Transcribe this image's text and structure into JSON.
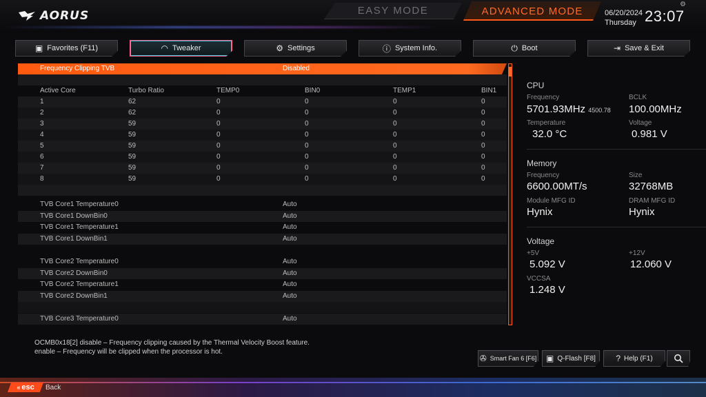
{
  "brand": {
    "logo_text": "AORUS"
  },
  "modes": {
    "easy": "EASY MODE",
    "advanced": "ADVANCED MODE"
  },
  "datetime": {
    "date": "06/20/2024",
    "day": "Thursday",
    "time": "23:07"
  },
  "tabs": [
    {
      "label": "Favorites (F11)",
      "icon": "favorites-icon"
    },
    {
      "label": "Tweaker",
      "icon": "speedometer-icon"
    },
    {
      "label": "Settings",
      "icon": "gear-icon"
    },
    {
      "label": "System Info.",
      "icon": "info-icon"
    },
    {
      "label": "Boot",
      "icon": "power-icon"
    },
    {
      "label": "Save & Exit",
      "icon": "exit-icon"
    }
  ],
  "main": {
    "highlight": {
      "label": "Frequency Clipping TVB",
      "value": "Disabled"
    },
    "table": {
      "headers": [
        "Active Core",
        "Turbo Ratio",
        "TEMP0",
        "BIN0",
        "TEMP1",
        "BIN1"
      ],
      "rows": [
        [
          "1",
          "62",
          "0",
          "0",
          "0",
          "0"
        ],
        [
          "2",
          "62",
          "0",
          "0",
          "0",
          "0"
        ],
        [
          "3",
          "59",
          "0",
          "0",
          "0",
          "0"
        ],
        [
          "4",
          "59",
          "0",
          "0",
          "0",
          "0"
        ],
        [
          "5",
          "59",
          "0",
          "0",
          "0",
          "0"
        ],
        [
          "6",
          "59",
          "0",
          "0",
          "0",
          "0"
        ],
        [
          "7",
          "59",
          "0",
          "0",
          "0",
          "0"
        ],
        [
          "8",
          "59",
          "0",
          "0",
          "0",
          "0"
        ]
      ]
    },
    "settings": [
      {
        "label": "TVB Core1 Temperature0",
        "value": "Auto"
      },
      {
        "label": "TVB Core1 DownBin0",
        "value": "Auto"
      },
      {
        "label": "TVB Core1 Temperature1",
        "value": "Auto"
      },
      {
        "label": "TVB Core1 DownBin1",
        "value": "Auto"
      },
      {
        "label": "TVB Core2 Temperature0",
        "value": "Auto"
      },
      {
        "label": "TVB Core2 DownBin0",
        "value": "Auto"
      },
      {
        "label": "TVB Core2 Temperature1",
        "value": "Auto"
      },
      {
        "label": "TVB Core2 DownBin1",
        "value": "Auto"
      },
      {
        "label": "TVB Core3 Temperature0",
        "value": "Auto"
      }
    ]
  },
  "info": {
    "cpu": {
      "title": "CPU",
      "freq_label": "Frequency",
      "freq_value": "5701.93MHz",
      "freq_sub": "4500.78",
      "bclk_label": "BCLK",
      "bclk_value": "100.00MHz",
      "temp_label": "Temperature",
      "temp_value": "32.0 °C",
      "volt_label": "Voltage",
      "volt_value": "0.981 V"
    },
    "memory": {
      "title": "Memory",
      "freq_label": "Frequency",
      "freq_value": "6600.00MT/s",
      "size_label": "Size",
      "size_value": "32768MB",
      "module_label": "Module MFG ID",
      "module_value": "Hynix",
      "dram_label": "DRAM MFG ID",
      "dram_value": "Hynix"
    },
    "voltage": {
      "title": "Voltage",
      "v5_label": "+5V",
      "v5_value": "5.092 V",
      "v12_label": "+12V",
      "v12_value": "12.060 V",
      "vccsa_label": "VCCSA",
      "vccsa_value": "1.248 V"
    }
  },
  "help": {
    "line1": "OCMB0x18[2] disable – Frequency clipping caused by the Thermal Velocity Boost feature.",
    "line2": "enable – Frequency will be clipped when the processor is hot."
  },
  "bottom_buttons": [
    {
      "label": "Smart Fan 6 [F6]",
      "icon": "fan-icon"
    },
    {
      "label": "Q-Flash [F8]",
      "icon": "chip-icon"
    },
    {
      "label": "Help (F1)",
      "icon": "question-icon"
    },
    {
      "label": "",
      "icon": "search-icon"
    }
  ],
  "footer": {
    "esc": "esc",
    "back": "Back"
  },
  "colors": {
    "accent": "#ff5a1a",
    "tab_active_border": "#ff5a8a",
    "tab_active_inner": "#3ec8d6"
  }
}
